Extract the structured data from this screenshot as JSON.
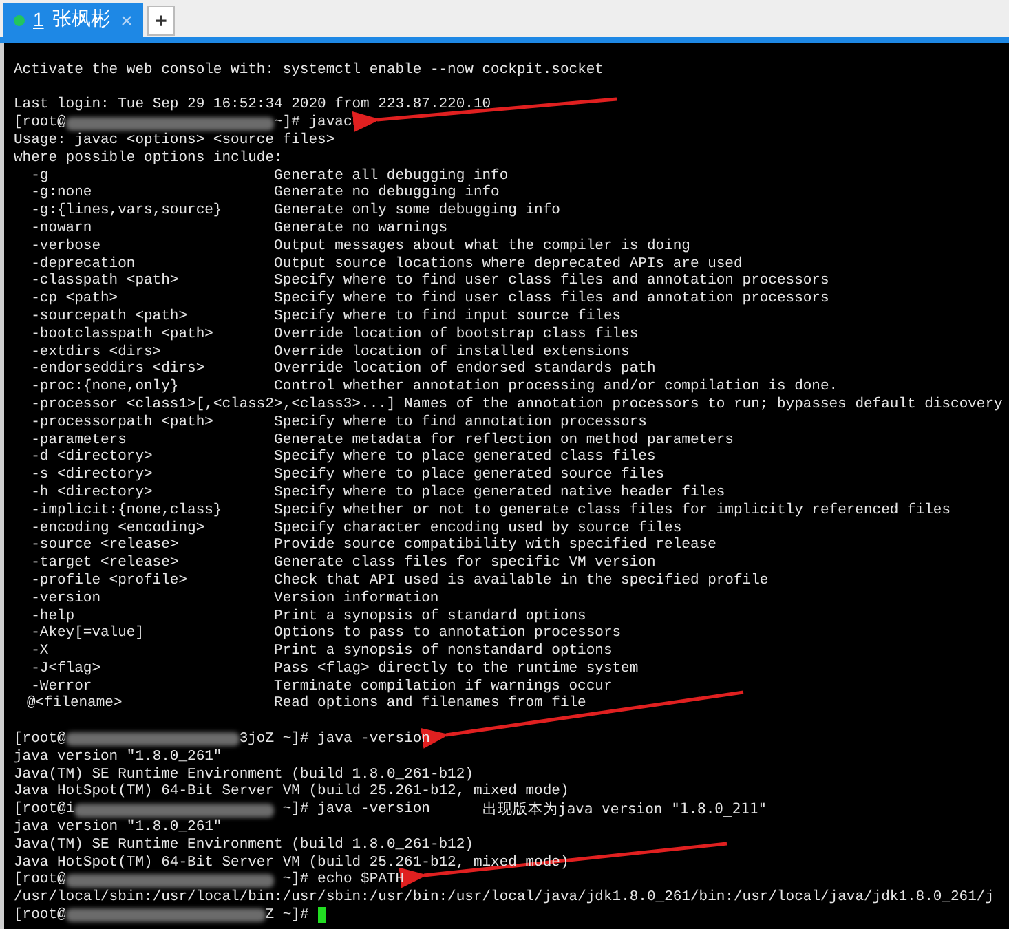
{
  "tabs": [
    {
      "number": "1",
      "label": "张枫彬",
      "selected": true,
      "connected": true
    }
  ],
  "new_tab": "+",
  "lines": [
    {
      "kind": "blank"
    },
    {
      "kind": "text",
      "text": "Activate the web console with: systemctl enable --now cockpit.socket"
    },
    {
      "kind": "blank"
    },
    {
      "kind": "text",
      "text": "Last login: Tue Sep 29 16:52:34 2020 from 223.87.220.10"
    },
    {
      "kind": "prompt",
      "user": "[root@",
      "rest": "~]# javac"
    },
    {
      "kind": "text",
      "text": "Usage: javac <options> <source files>"
    },
    {
      "kind": "text",
      "text": "where possible options include:"
    },
    {
      "kind": "option",
      "option": "-g",
      "description": "Generate all debugging info"
    },
    {
      "kind": "option",
      "option": "-g:none",
      "description": "Generate no debugging info"
    },
    {
      "kind": "option",
      "option": "-g:{lines,vars,source}",
      "description": "Generate only some debugging info"
    },
    {
      "kind": "option",
      "option": "-nowarn",
      "description": "Generate no warnings"
    },
    {
      "kind": "option",
      "option": "-verbose",
      "description": "Output messages about what the compiler is doing"
    },
    {
      "kind": "option",
      "option": "-deprecation",
      "description": "Output source locations where deprecated APIs are used"
    },
    {
      "kind": "option",
      "option": "-classpath <path>",
      "description": "Specify where to find user class files and annotation processors"
    },
    {
      "kind": "option",
      "option": "-cp <path>",
      "description": "Specify where to find user class files and annotation processors"
    },
    {
      "kind": "option",
      "option": "-sourcepath <path>",
      "description": "Specify where to find input source files"
    },
    {
      "kind": "option",
      "option": "-bootclasspath <path>",
      "description": "Override location of bootstrap class files"
    },
    {
      "kind": "option",
      "option": "-extdirs <dirs>",
      "description": "Override location of installed extensions"
    },
    {
      "kind": "option",
      "option": "-endorseddirs <dirs>",
      "description": "Override location of endorsed standards path"
    },
    {
      "kind": "option",
      "option": "-proc:{none,only}",
      "description": "Control whether annotation processing and/or compilation is done."
    },
    {
      "kind": "option",
      "option": "-processor <class1>[,<class2>,<class3>...]",
      "description": "Names of the annotation processors to run; bypasses default discovery"
    },
    {
      "kind": "option",
      "option": "-processorpath <path>",
      "description": "Specify where to find annotation processors"
    },
    {
      "kind": "option",
      "option": "-parameters",
      "description": "Generate metadata for reflection on method parameters"
    },
    {
      "kind": "option",
      "option": "-d <directory>",
      "description": "Specify where to place generated class files"
    },
    {
      "kind": "option",
      "option": "-s <directory>",
      "description": "Specify where to place generated source files"
    },
    {
      "kind": "option",
      "option": "-h <directory>",
      "description": "Specify where to place generated native header files"
    },
    {
      "kind": "option",
      "option": "-implicit:{none,class}",
      "description": "Specify whether or not to generate class files for implicitly referenced files"
    },
    {
      "kind": "option",
      "option": "-encoding <encoding>",
      "description": "Specify character encoding used by source files"
    },
    {
      "kind": "option",
      "option": "-source <release>",
      "description": "Provide source compatibility with specified release"
    },
    {
      "kind": "option",
      "option": "-target <release>",
      "description": "Generate class files for specific VM version"
    },
    {
      "kind": "option",
      "option": "-profile <profile>",
      "description": "Check that API used is available in the specified profile"
    },
    {
      "kind": "option",
      "option": "-version",
      "description": "Version information"
    },
    {
      "kind": "option",
      "option": "-help",
      "description": "Print a synopsis of standard options"
    },
    {
      "kind": "option",
      "option": "-Akey[=value]",
      "description": "Options to pass to annotation processors"
    },
    {
      "kind": "option",
      "option": "-X",
      "description": "Print a synopsis of nonstandard options"
    },
    {
      "kind": "option",
      "option": "-J<flag>",
      "description": "Pass <flag> directly to the runtime system"
    },
    {
      "kind": "option",
      "option": "-Werror",
      "description": "Terminate compilation if warnings occur"
    },
    {
      "kind": "option",
      "option": "@<filename>",
      "description": "Read options and filenames from file",
      "at": true
    },
    {
      "kind": "blank"
    },
    {
      "kind": "prompt",
      "user": "[root@",
      "host_end": "3joZ",
      "rest": " ~]# java -version"
    },
    {
      "kind": "text",
      "text": "java version \"1.8.0_261\""
    },
    {
      "kind": "text",
      "text": "Java(TM) SE Runtime Environment (build 1.8.0_261-b12)"
    },
    {
      "kind": "text",
      "text": "Java HotSpot(TM) 64-Bit Server VM (build 25.261-b12, mixed mode)"
    },
    {
      "kind": "prompt",
      "user": "[root@",
      "host_start": "i",
      "rest": " ~]# java -version",
      "note": "出现版本为java version \"1.8.0_211\""
    },
    {
      "kind": "text",
      "text": "java version \"1.8.0_261\""
    },
    {
      "kind": "text",
      "text": "Java(TM) SE Runtime Environment (build 1.8.0_261-b12)"
    },
    {
      "kind": "text",
      "text": "Java HotSpot(TM) 64-Bit Server VM (build 25.261-b12, mixed mode)"
    },
    {
      "kind": "prompt",
      "user": "[root@",
      "rest": " ~]# echo $PATH"
    },
    {
      "kind": "text",
      "text": "/usr/local/sbin:/usr/local/bin:/usr/sbin:/usr/bin:/usr/local/java/jdk1.8.0_261/bin:/usr/local/java/jdk1.8.0_261/j"
    },
    {
      "kind": "prompt",
      "user": "[root@",
      "host_end": "Z",
      "rest": " ~]# ",
      "cursor": true
    }
  ]
}
